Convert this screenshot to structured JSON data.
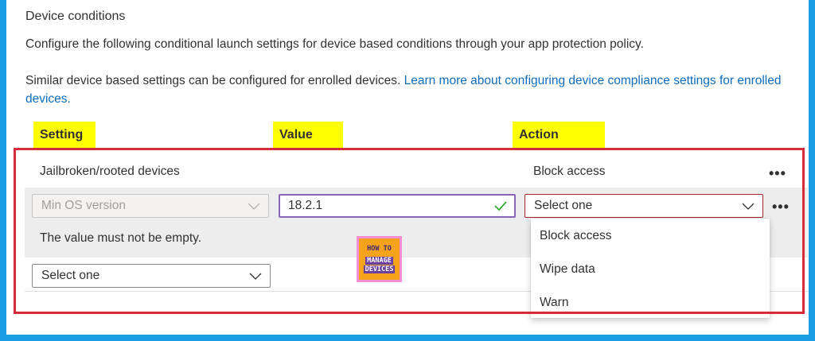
{
  "section": {
    "title": "Device conditions",
    "description": "Configure the following conditional launch settings for device based conditions through your app protection policy.",
    "enrolled_text": "Similar device based settings can be configured for enrolled devices. ",
    "learn_more_link": "Learn more about configuring device compliance settings for enrolled devices."
  },
  "table": {
    "headers": {
      "setting": "Setting",
      "value": "Value",
      "action": "Action"
    },
    "rows": [
      {
        "setting": "Jailbroken/rooted devices",
        "value": "",
        "action": "Block access"
      }
    ],
    "editing_row": {
      "setting": "Min OS version",
      "value": "18.2.1",
      "action_placeholder": "Select one",
      "validation_message": "The value must not be empty."
    },
    "new_row": {
      "setting_placeholder": "Select one"
    },
    "more_label": "•••"
  },
  "action_options": [
    "Block access",
    "Wipe data",
    "Warn"
  ],
  "watermark": {
    "line1": "HOW TO",
    "line2": "MANAGE",
    "line3": "DEVICES"
  },
  "colors": {
    "background": "#1a9ee6",
    "highlight": "#ffff00",
    "frame": "#d62c3a",
    "link": "#0f6cbd",
    "focus": "#8764b8",
    "valid_check": "#107c10"
  },
  "icons": {
    "chevron": "chevron-down-icon",
    "check": "checkmark-icon",
    "more": "more-icon"
  }
}
